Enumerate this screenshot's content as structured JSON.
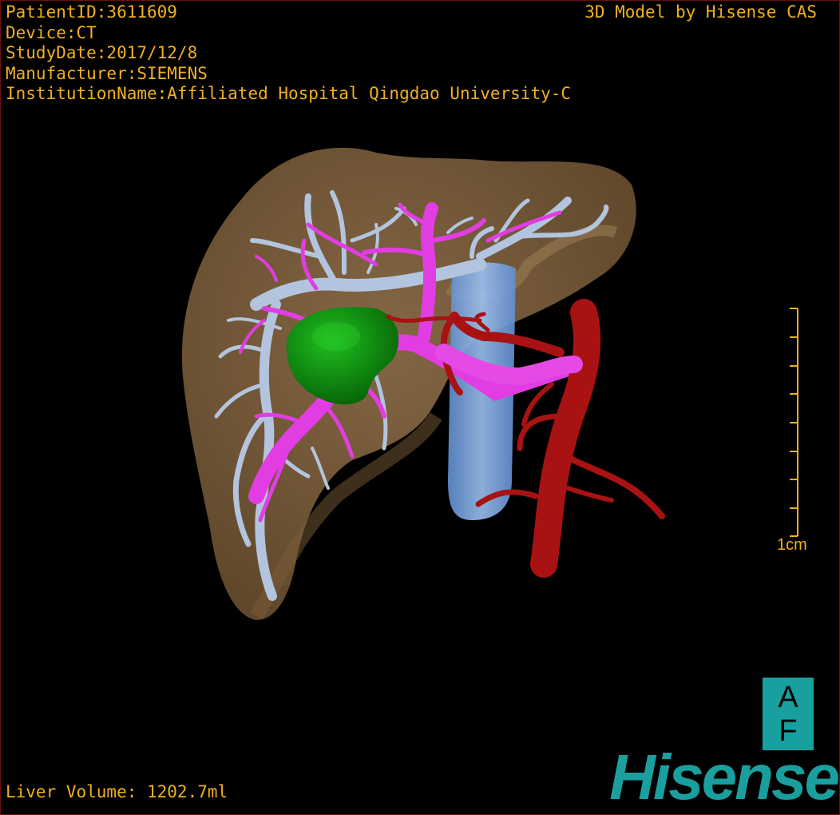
{
  "info": {
    "patient_id": "PatientID:3611609",
    "device": "Device:CT",
    "study_date": "StudyDate:2017/12/8",
    "manufacturer": "Manufacturer:SIEMENS",
    "institution": "InstitutionName:Affiliated Hospital Qingdao University-C"
  },
  "brand_text": "3D Model by Hisense CAS",
  "scale_label": "1cm",
  "orientation": {
    "top": "A",
    "bottom": "F"
  },
  "liver_volume": "Liver Volume: 1202.7ml",
  "logo": "Hisense",
  "colors": {
    "text": "#f0b020",
    "liver": "#8a6a45",
    "tumor": "#0c8c0c",
    "portal_vein": "#e040e0",
    "hepatic_vein": "#b0c4e0",
    "ivc": "#7aa8e0",
    "artery": "#a01010",
    "logo": "#1a9e9e"
  }
}
